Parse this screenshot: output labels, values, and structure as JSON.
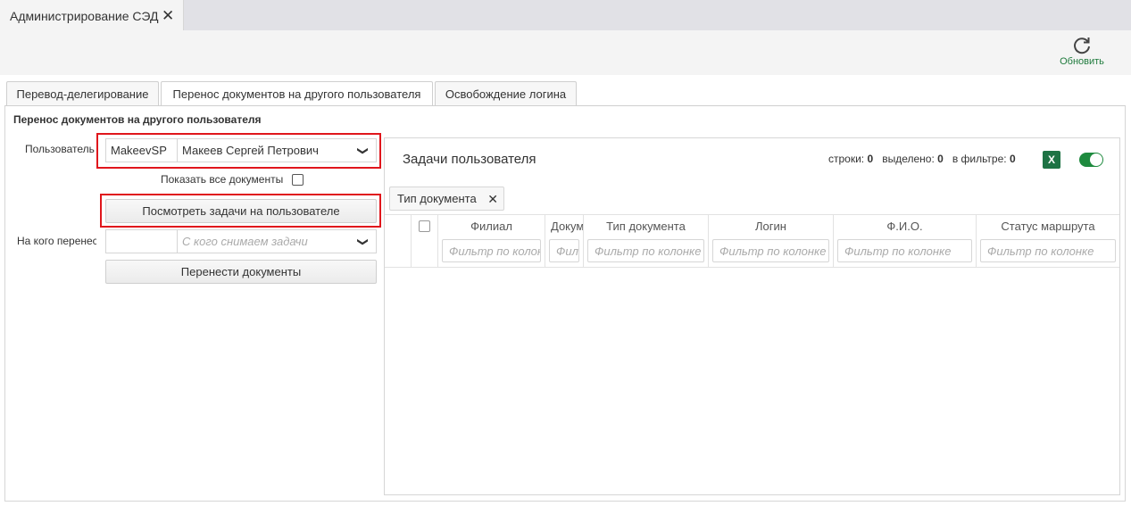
{
  "window": {
    "doc_tab_title": "Администрирование СЭД",
    "close_glyph": "✕",
    "refresh_label": "Обновить"
  },
  "tabs": [
    {
      "label": "Перевод-делегирование",
      "active": false
    },
    {
      "label": "Перенос документов на другого пользователя",
      "active": true
    },
    {
      "label": "Освобождение логина",
      "active": false
    }
  ],
  "form": {
    "title": "Перенос документов на другого пользователя",
    "user_label": "Пользователь",
    "user_login": "MakeevSP",
    "user_name": "Макеев Сергей Петрович",
    "show_all_label": "Показать все документы",
    "view_tasks_button": "Посмотреть задачи на пользователе",
    "target_label": "На кого перенести",
    "target_login": "",
    "target_placeholder": "С кого снимаем задачи",
    "transfer_button": "Перенести документы",
    "chevron": "❯"
  },
  "grid": {
    "title": "Задачи пользователя",
    "stats": {
      "rows_label": "строки:",
      "rows": "0",
      "selected_label": "выделено:",
      "selected": "0",
      "filter_label": "в фильтре:",
      "filtered": "0"
    },
    "excel_icon_text": "X",
    "toggle_on": true,
    "group_chip": "Тип документа",
    "chip_close": "✕",
    "columns": [
      {
        "header": "Филиал",
        "filter": "Фильтр по колонке"
      },
      {
        "header": "Документ",
        "filter": "Фильтр по колонке"
      },
      {
        "header": "Тип документа",
        "filter": "Фильтр по колонке"
      },
      {
        "header": "Логин",
        "filter": "Фильтр по колонке"
      },
      {
        "header": "Ф.И.О.",
        "filter": "Фильтр по колонке"
      },
      {
        "header": "Статус маршрута",
        "filter": "Фильтр по колонке"
      }
    ],
    "colors": {
      "accent_green": "#1e8a3e",
      "excel_green": "#1e7345",
      "highlight_red": "#e0161c"
    }
  }
}
